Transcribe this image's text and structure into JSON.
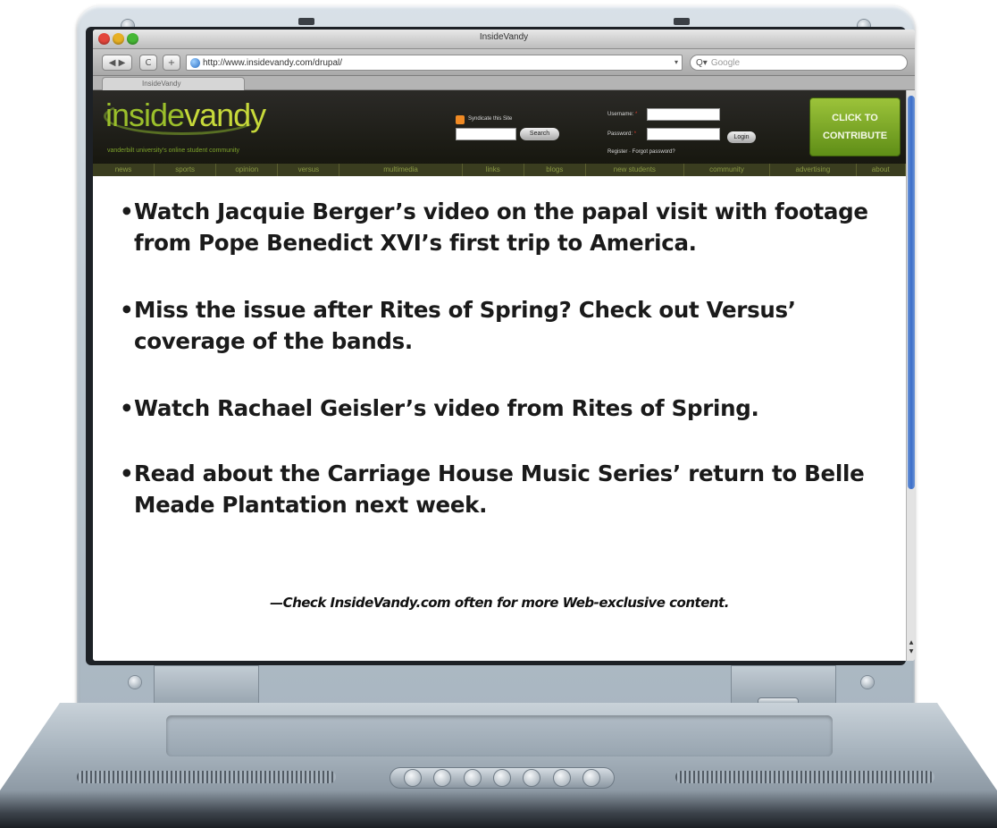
{
  "browser": {
    "window_title": "InsideVandy",
    "url": "http://www.insidevandy.com/drupal/",
    "search_placeholder": "Google",
    "tab_label": "InsideVandy",
    "back_forward": "◀ ▶",
    "reload_glyph": "C",
    "add_glyph": "+"
  },
  "site": {
    "logo_inside": "inside",
    "logo_vandy": "vandy",
    "tagline": "vanderbilt university's online student community",
    "syndicate_label": "Syndicate this Site",
    "search_button": "Search",
    "username_label": "Username:",
    "password_label": "Password:",
    "required_mark": "*",
    "login_button": "Login",
    "register_links": "Register · Forgot password?",
    "contribute_line1": "CLICK TO",
    "contribute_line2": "CONTRIBUTE",
    "nav": [
      "news",
      "sports",
      "opinion",
      "versus",
      "multimedia",
      "links",
      "blogs",
      "new students",
      "community",
      "advertising",
      "about"
    ]
  },
  "content": {
    "bullets": [
      "Watch Jacquie Berger’s video on the papal visit with footage from Pope Benedict XVI’s first trip to America.",
      "Miss the issue after Rites of Spring? Check out Versus’ coverage of the bands.",
      "Watch Rachael Geisler’s video from Rites of Spring.",
      "Read about the Carriage House Music Series’ return to Belle Meade Plantation next week."
    ],
    "signoff": "—Check InsideVandy.com often for more Web-exclusive content."
  },
  "colors": {
    "logo_green": "#9bbf2b",
    "contribute_green": "#7aa628",
    "header_dark": "#1e1e18",
    "scroll_blue": "#3b6ec9"
  }
}
